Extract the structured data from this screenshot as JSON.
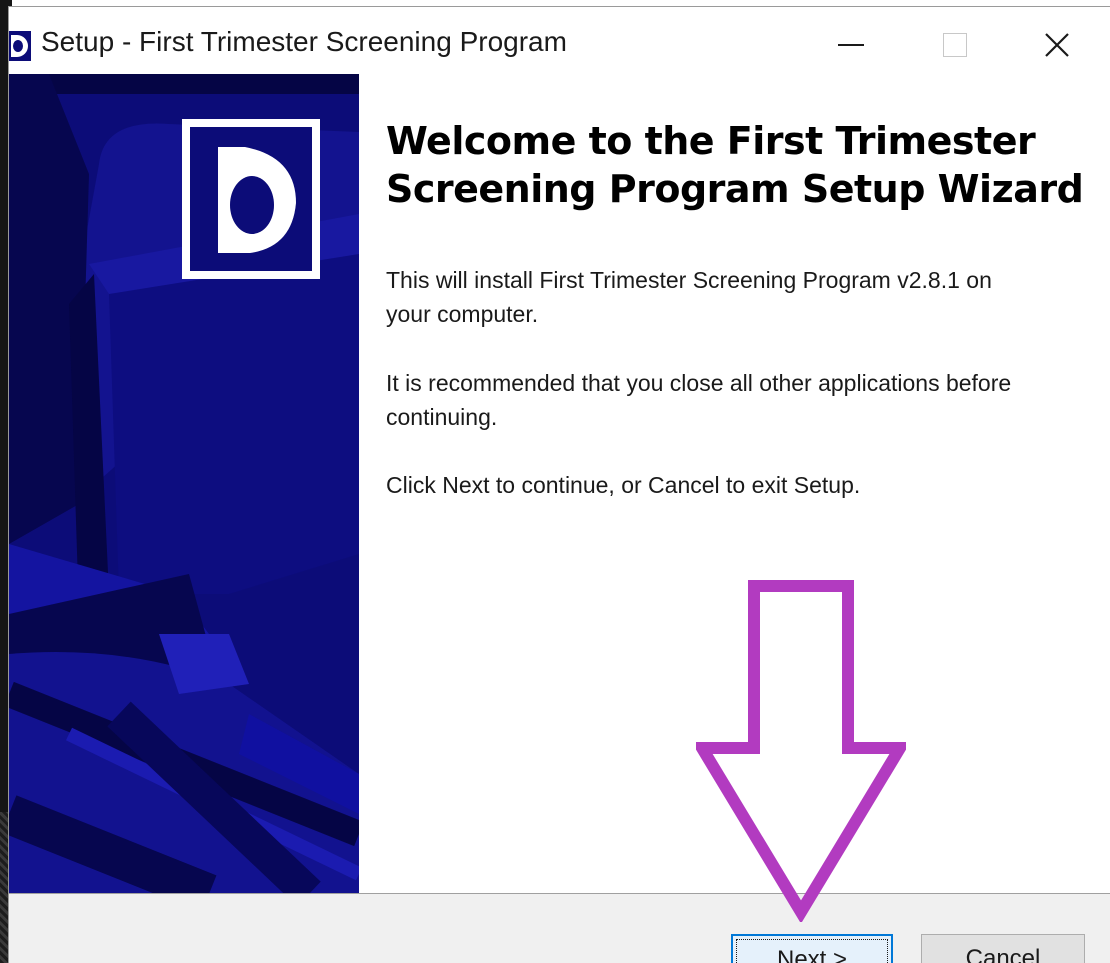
{
  "window": {
    "title": "Setup - First Trimester Screening Program",
    "controls": {
      "minimize_icon": "minimize-icon",
      "maximize_icon": "maximize-icon",
      "close_icon": "close-icon"
    }
  },
  "banner": {
    "logo_icon": "app-logo-icon",
    "background_color": "#0c0c78"
  },
  "content": {
    "heading_line1": "Welcome to the First Trimester",
    "heading_line2": "Screening Program Setup Wizard",
    "paragraph_install_line1": "This will install First Trimester Screening Program v2.8.1 on",
    "paragraph_install_line2": "your computer.",
    "paragraph_recommend_line1": "It is recommended that you close all other applications before",
    "paragraph_recommend_line2": "continuing.",
    "paragraph_instructions": "Click Next to continue, or Cancel to exit Setup."
  },
  "annotation": {
    "icon": "down-arrow-icon",
    "color": "#b23bc0"
  },
  "footer": {
    "next_label": "Next >",
    "cancel_label": "Cancel"
  }
}
